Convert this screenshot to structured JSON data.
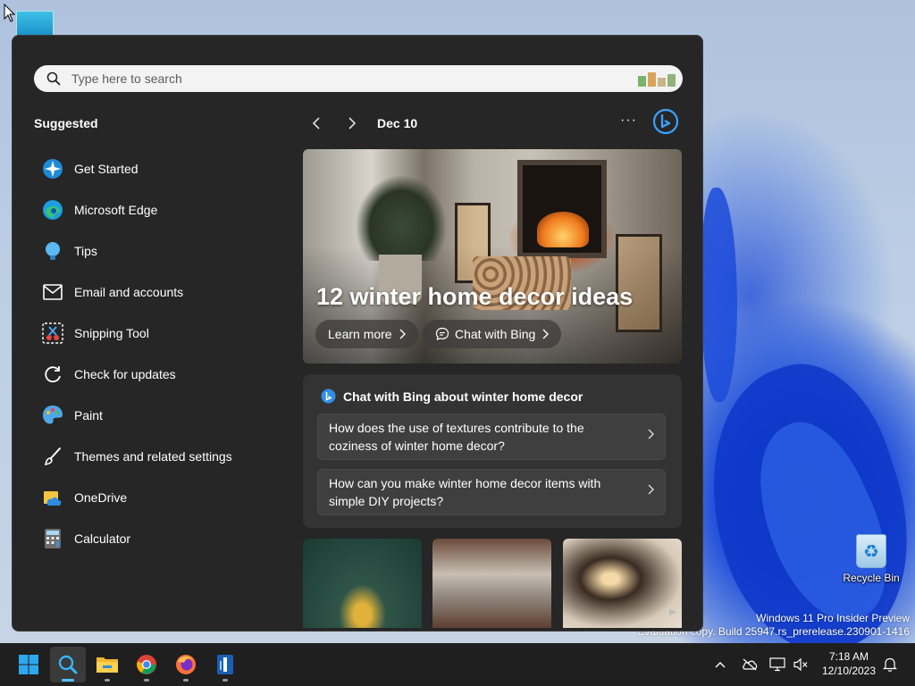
{
  "search": {
    "placeholder": "Type here to search"
  },
  "suggested": {
    "title": "Suggested",
    "items": [
      {
        "label": "Get Started",
        "icon": "get-started-icon"
      },
      {
        "label": "Microsoft Edge",
        "icon": "edge-icon"
      },
      {
        "label": "Tips",
        "icon": "tips-bulb-icon"
      },
      {
        "label": "Email and accounts",
        "icon": "mail-icon"
      },
      {
        "label": "Snipping Tool",
        "icon": "snipping-tool-icon"
      },
      {
        "label": "Check for updates",
        "icon": "refresh-icon"
      },
      {
        "label": "Paint",
        "icon": "paint-palette-icon"
      },
      {
        "label": "Themes and related settings",
        "icon": "brush-icon"
      },
      {
        "label": "OneDrive",
        "icon": "onedrive-icon"
      },
      {
        "label": "Calculator",
        "icon": "calculator-icon"
      }
    ]
  },
  "highlights": {
    "date": "Dec 10",
    "more": "···",
    "hero": {
      "title": "12 winter home decor ideas",
      "learn_more": "Learn more",
      "chat_bing": "Chat with Bing"
    },
    "chat": {
      "heading": "Chat with Bing about winter home decor",
      "questions": [
        "How does the use of textures contribute to the coziness of winter home decor?",
        "How can you make winter home decor items with simple DIY projects?"
      ]
    }
  },
  "desktop": {
    "recycle_bin": "Recycle Bin",
    "watermark_line1": "Windows 11 Pro Insider Preview",
    "watermark_line2": "Evaluation copy. Build 25947.rs_prerelease.230901-1416"
  },
  "taskbar": {
    "time": "7:18 AM",
    "date": "12/10/2023",
    "apps": [
      "start-icon",
      "search-icon",
      "file-explorer-icon",
      "chrome-icon",
      "firefox-icon",
      "app-icon"
    ]
  },
  "colors": {
    "accent": "#4cc2ff",
    "panel_bg": "#262626",
    "card_bg": "#333333",
    "taskbar_bg": "#1f1f1f"
  }
}
